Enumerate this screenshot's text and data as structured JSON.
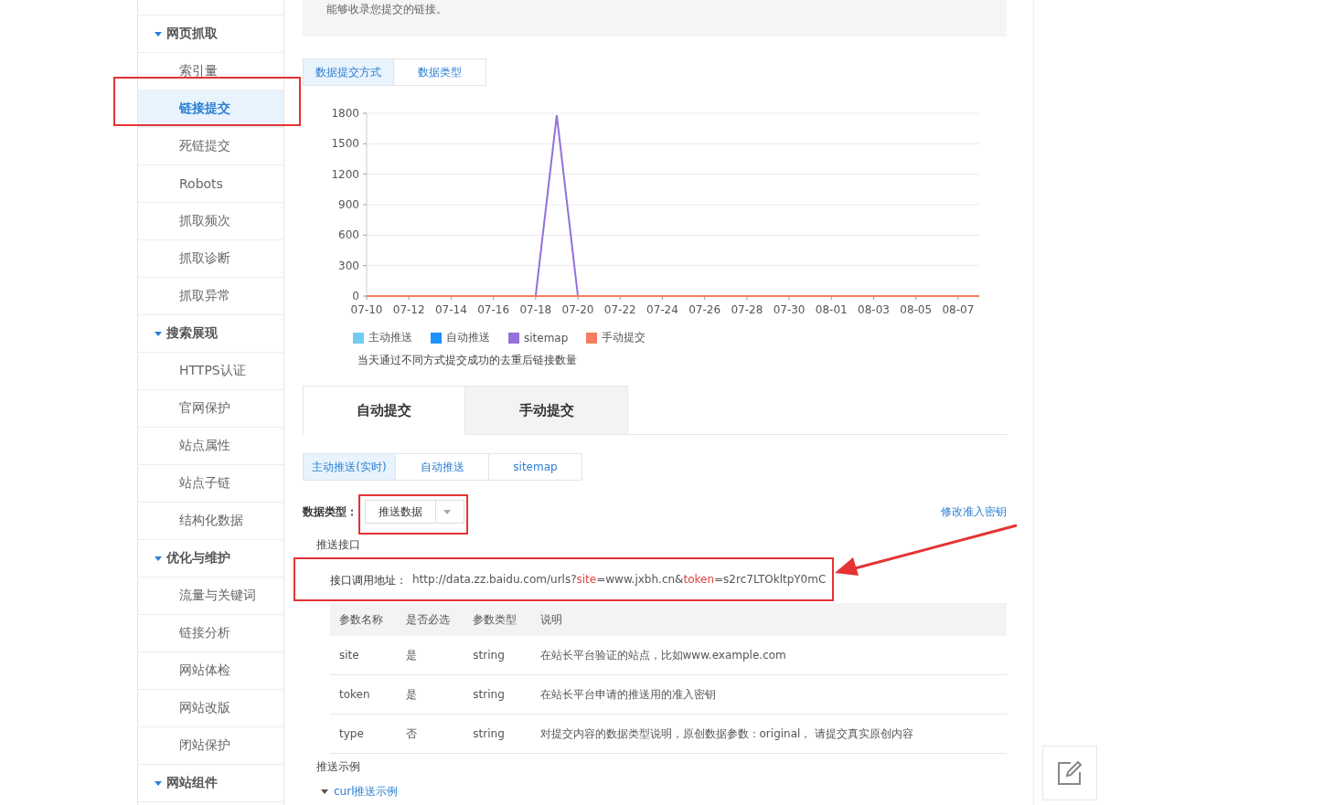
{
  "sidebar": {
    "groups": [
      {
        "label": "网页抓取",
        "expanded": true,
        "children": [
          {
            "label": "索引量",
            "selected": false
          },
          {
            "label": "链接提交",
            "selected": true
          },
          {
            "label": "死链提交",
            "selected": false
          },
          {
            "label": "Robots",
            "selected": false
          },
          {
            "label": "抓取频次",
            "selected": false
          },
          {
            "label": "抓取诊断",
            "selected": false
          },
          {
            "label": "抓取异常",
            "selected": false
          }
        ]
      },
      {
        "label": "搜索展现",
        "expanded": true,
        "children": [
          {
            "label": "HTTPS认证",
            "selected": false
          },
          {
            "label": "官网保护",
            "selected": false
          },
          {
            "label": "站点属性",
            "selected": false
          },
          {
            "label": "站点子链",
            "selected": false
          },
          {
            "label": "结构化数据",
            "selected": false
          }
        ]
      },
      {
        "label": "优化与维护",
        "expanded": true,
        "children": [
          {
            "label": "流量与关键词",
            "selected": false
          },
          {
            "label": "链接分析",
            "selected": false
          },
          {
            "label": "网站体检",
            "selected": false
          },
          {
            "label": "网站改版",
            "selected": false
          },
          {
            "label": "闭站保护",
            "selected": false
          }
        ]
      },
      {
        "label": "网站组件",
        "expanded": true
      }
    ]
  },
  "notice": {
    "text": "能够收录您提交的链接。"
  },
  "chart_tabs": [
    {
      "label": "数据提交方式",
      "selected": true
    },
    {
      "label": "数据类型",
      "selected": false
    }
  ],
  "chart": {
    "chart_data": {
      "type": "line",
      "categories": [
        "07-10",
        null,
        "07-12",
        null,
        "07-14",
        null,
        "07-16",
        null,
        "07-18",
        null,
        "07-20",
        null,
        "07-22",
        null,
        "07-24",
        null,
        "07-26",
        null,
        "07-28",
        null,
        "07-30",
        null,
        "08-01",
        null,
        "08-03",
        null,
        "08-05",
        null,
        "08-07",
        null
      ],
      "yticks": [
        0,
        300,
        600,
        900,
        1200,
        1500,
        1800
      ],
      "ylim": [
        0,
        1800
      ],
      "grid": true,
      "series": [
        {
          "name": "主动推送",
          "color": "#6fcdf5",
          "values": [
            null,
            null,
            null,
            null,
            null,
            null,
            null,
            null,
            null,
            null,
            null,
            null,
            null,
            null,
            null,
            null,
            null,
            null,
            null,
            null,
            null,
            null,
            null,
            null,
            null,
            null,
            null,
            null,
            null,
            null
          ]
        },
        {
          "name": "自动推送",
          "color": "#1e90ff",
          "values": [
            null,
            null,
            null,
            null,
            null,
            null,
            null,
            null,
            null,
            null,
            null,
            null,
            null,
            null,
            null,
            null,
            null,
            null,
            null,
            null,
            null,
            null,
            null,
            null,
            null,
            null,
            null,
            null,
            null,
            null
          ]
        },
        {
          "name": "sitemap",
          "color": "#9370db",
          "values": [
            null,
            null,
            null,
            null,
            null,
            null,
            null,
            null,
            0,
            1780,
            0,
            null,
            null,
            null,
            null,
            null,
            null,
            null,
            null,
            null,
            null,
            null,
            null,
            null,
            null,
            null,
            null,
            null,
            null,
            null
          ]
        },
        {
          "name": "手动提交",
          "color": "#f57b5f",
          "values": [
            0,
            0,
            0,
            0,
            0,
            0,
            0,
            0,
            0,
            0,
            0,
            0,
            0,
            0,
            0,
            0,
            0,
            0,
            0,
            0,
            0,
            0,
            0,
            0,
            0,
            0,
            0,
            0,
            0,
            0
          ]
        }
      ]
    },
    "caption": "当天通过不同方式提交成功的去重后链接数量"
  },
  "main_tabs": [
    {
      "label": "自动提交",
      "selected": true
    },
    {
      "label": "手动提交",
      "selected": false
    }
  ],
  "sub_tabs": [
    {
      "label": "主动推送(实时)",
      "selected": true
    },
    {
      "label": "自动推送",
      "selected": false
    },
    {
      "label": "sitemap",
      "selected": false
    }
  ],
  "data_type": {
    "label": "数据类型：",
    "value": "推送数据"
  },
  "key_link": "修改准入密钥",
  "push_api": {
    "title": "推送接口",
    "url_label": "接口调用地址：",
    "url_parts": [
      {
        "text": "http://data.zz.baidu.com/urls?",
        "kind": "plain"
      },
      {
        "text": "site",
        "kind": "param"
      },
      {
        "text": "=www.jxbh.cn&",
        "kind": "plain"
      },
      {
        "text": "token",
        "kind": "param"
      },
      {
        "text": "=s2rc7LTOkltpY0mC",
        "kind": "plain"
      }
    ]
  },
  "params_table": {
    "columns": [
      "参数名称",
      "是否必选",
      "参数类型",
      "说明"
    ],
    "rows": [
      [
        "site",
        "是",
        "string",
        "在站长平台验证的站点，比如www.example.com"
      ],
      [
        "token",
        "是",
        "string",
        "在站长平台申请的推送用的准入密钥"
      ],
      [
        "type",
        "否",
        "string",
        "对提交内容的数据类型说明，原创数据参数：original， 请提交真实原创内容"
      ]
    ]
  },
  "example": {
    "title": "推送示例",
    "toggle": {
      "label": "curl推送示例",
      "expanded": true
    }
  }
}
